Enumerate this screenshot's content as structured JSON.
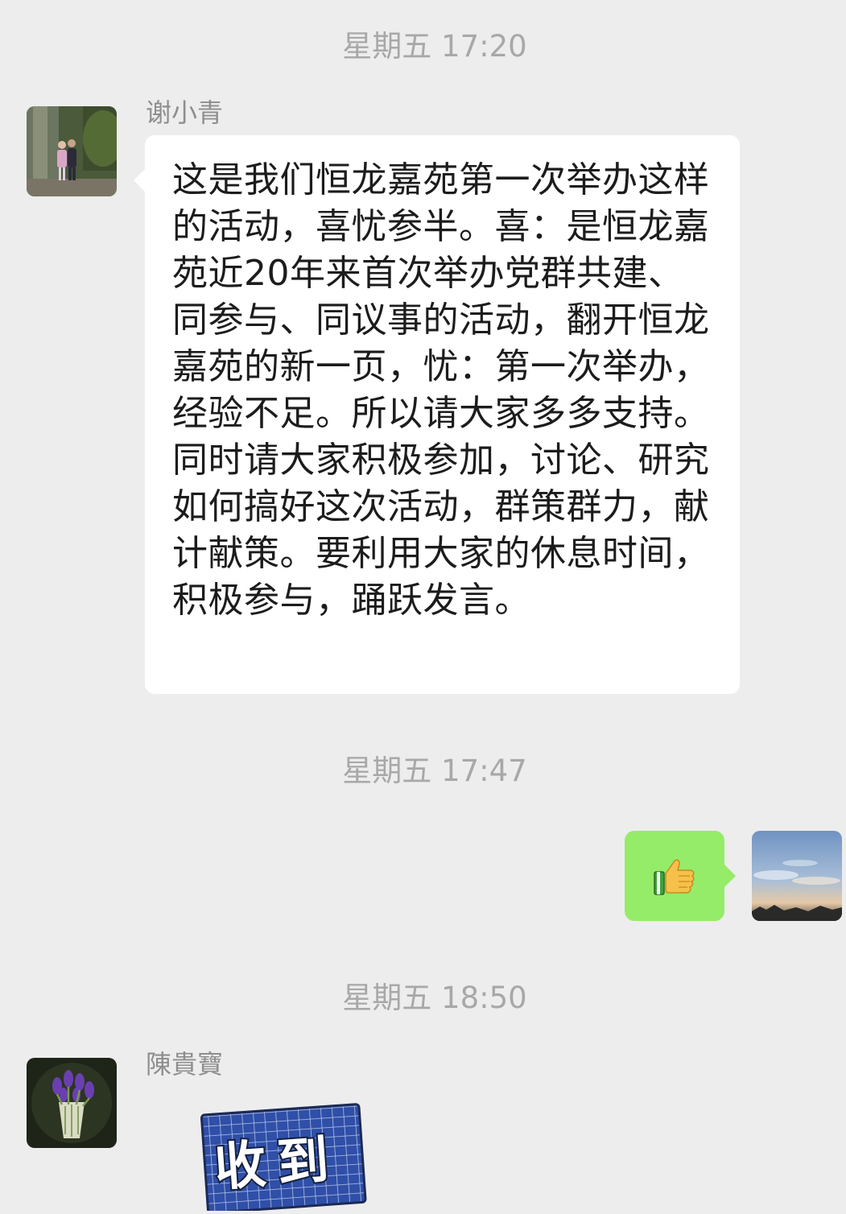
{
  "messages": {
    "time1": "星期五 17:20",
    "sender1_name": "谢小青",
    "sender1_text": "这是我们恒龙嘉苑第一次举办这样的活动，喜忧参半。喜：是恒龙嘉苑近20年来首次举办党群共建、同参与、同议事的活动，翻开恒龙嘉苑的新一页，忧：第一次举办，经验不足。所以请大家多多支持。同时请大家积极参加，讨论、研究如何搞好这次活动，群策群力，献计献策。要利用大家的休息时间，积极参与，踊跃发言。",
    "time2": "星期五 17:47",
    "self_reaction_icon": "thumbs-up-emoji",
    "time3": "星期五 18:50",
    "sender2_name": "陳貴寶",
    "sticker_text": "收到"
  },
  "colors": {
    "background": "#ededed",
    "incoming_bubble": "#ffffff",
    "outgoing_bubble": "#95ec69",
    "timestamp": "#a8a8a8",
    "name": "#8e8e8e"
  }
}
